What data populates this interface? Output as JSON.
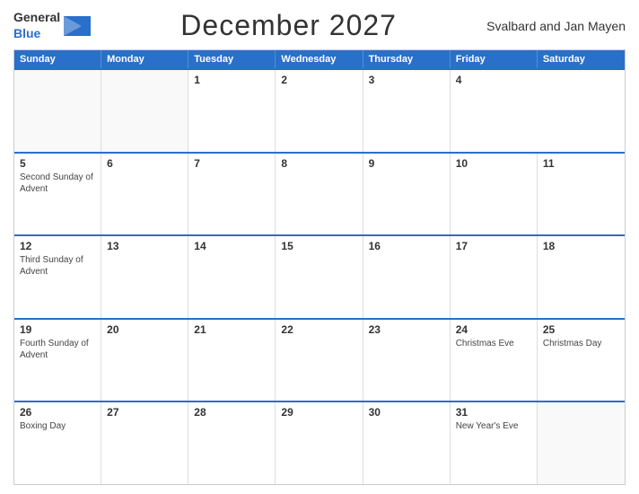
{
  "header": {
    "logo": {
      "general": "General",
      "blue": "Blue"
    },
    "title": "December 2027",
    "region": "Svalbard and Jan Mayen"
  },
  "calendar": {
    "days_of_week": [
      "Sunday",
      "Monday",
      "Tuesday",
      "Wednesday",
      "Thursday",
      "Friday",
      "Saturday"
    ],
    "weeks": [
      [
        {
          "day": "",
          "events": []
        },
        {
          "day": "",
          "events": []
        },
        {
          "day": "1",
          "events": []
        },
        {
          "day": "2",
          "events": []
        },
        {
          "day": "3",
          "events": []
        },
        {
          "day": "4",
          "events": []
        }
      ],
      [
        {
          "day": "5",
          "events": [
            "Second Sunday of Advent"
          ]
        },
        {
          "day": "6",
          "events": []
        },
        {
          "day": "7",
          "events": []
        },
        {
          "day": "8",
          "events": []
        },
        {
          "day": "9",
          "events": []
        },
        {
          "day": "10",
          "events": []
        },
        {
          "day": "11",
          "events": []
        }
      ],
      [
        {
          "day": "12",
          "events": [
            "Third Sunday of Advent"
          ]
        },
        {
          "day": "13",
          "events": []
        },
        {
          "day": "14",
          "events": []
        },
        {
          "day": "15",
          "events": []
        },
        {
          "day": "16",
          "events": []
        },
        {
          "day": "17",
          "events": []
        },
        {
          "day": "18",
          "events": []
        }
      ],
      [
        {
          "day": "19",
          "events": [
            "Fourth Sunday of Advent"
          ]
        },
        {
          "day": "20",
          "events": []
        },
        {
          "day": "21",
          "events": []
        },
        {
          "day": "22",
          "events": []
        },
        {
          "day": "23",
          "events": []
        },
        {
          "day": "24",
          "events": [
            "Christmas Eve"
          ]
        },
        {
          "day": "25",
          "events": [
            "Christmas Day"
          ]
        }
      ],
      [
        {
          "day": "26",
          "events": [
            "Boxing Day"
          ]
        },
        {
          "day": "27",
          "events": []
        },
        {
          "day": "28",
          "events": []
        },
        {
          "day": "29",
          "events": []
        },
        {
          "day": "30",
          "events": []
        },
        {
          "day": "31",
          "events": [
            "New Year's Eve"
          ]
        },
        {
          "day": "",
          "events": []
        }
      ]
    ]
  }
}
